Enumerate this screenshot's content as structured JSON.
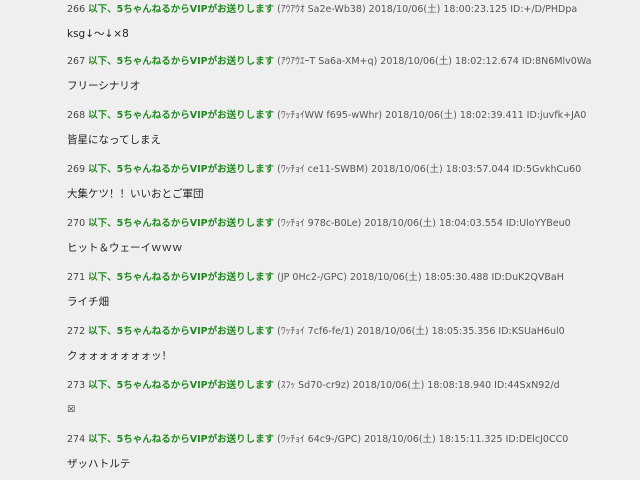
{
  "posts": [
    {
      "num": "266",
      "name": "以下、5ちゃんねるからVIPがお送りします",
      "meta": "(ｱｳｱｳｵ Sa2e-Wb38) 2018/10/06(土) 18:00:23.125 ID:+/D/PHDpa",
      "body": "ksg↓～↓×8"
    },
    {
      "num": "267",
      "name": "以下、5ちゃんねるからVIPがお送りします",
      "meta": "(ｱｳｱｳｴｰT Sa6a-XM+q) 2018/10/06(土) 18:02:12.674 ID:8N6Mlv0Wa",
      "body": "フリーシナリオ"
    },
    {
      "num": "268",
      "name": "以下、5ちゃんねるからVIPがお送りします",
      "meta": "(ﾜｯﾁｮｲWW f695-wWhr) 2018/10/06(土) 18:02:39.411 ID:juvfk+JA0",
      "body": "皆星になってしまえ"
    },
    {
      "num": "269",
      "name": "以下、5ちゃんねるからVIPがお送りします",
      "meta": "(ﾜｯﾁｮｲ ce11-SWBM) 2018/10/06(土) 18:03:57.044 ID:5GvkhCu60",
      "body": "大集ケツ！！いいおとご軍団"
    },
    {
      "num": "270",
      "name": "以下、5ちゃんねるからVIPがお送りします",
      "meta": "(ﾜｯﾁｮｲ 978c-B0Le) 2018/10/06(土) 18:04:03.554 ID:UloYYBeu0",
      "body": "ヒット＆ウェーイｗｗｗ"
    },
    {
      "num": "271",
      "name": "以下、5ちゃんねるからVIPがお送りします",
      "meta": "(JP 0Hc2-/GPC) 2018/10/06(土) 18:05:30.488 ID:DuK2QVBaH",
      "body": "ライチ畑"
    },
    {
      "num": "272",
      "name": "以下、5ちゃんねるからVIPがお送りします",
      "meta": "(ﾜｯﾁｮｲ 7cf6-fe/1) 2018/10/06(土) 18:05:35.356 ID:KSUaH6ul0",
      "body": "クォォォォォォォッ！"
    },
    {
      "num": "273",
      "name": "以下、5ちゃんねるからVIPがお送りします",
      "meta": "(ｽﾌｯ Sd70-cr9z) 2018/10/06(土) 18:08:18.940 ID:44SxN92/d",
      "body": "☒"
    },
    {
      "num": "274",
      "name": "以下、5ちゃんねるからVIPがお送りします",
      "meta": "(ﾜｯﾁｮｲ 64c9-/GPC) 2018/10/06(土) 18:15:11.325 ID:DElcJ0CC0",
      "body": "ザッハトルテ"
    }
  ]
}
